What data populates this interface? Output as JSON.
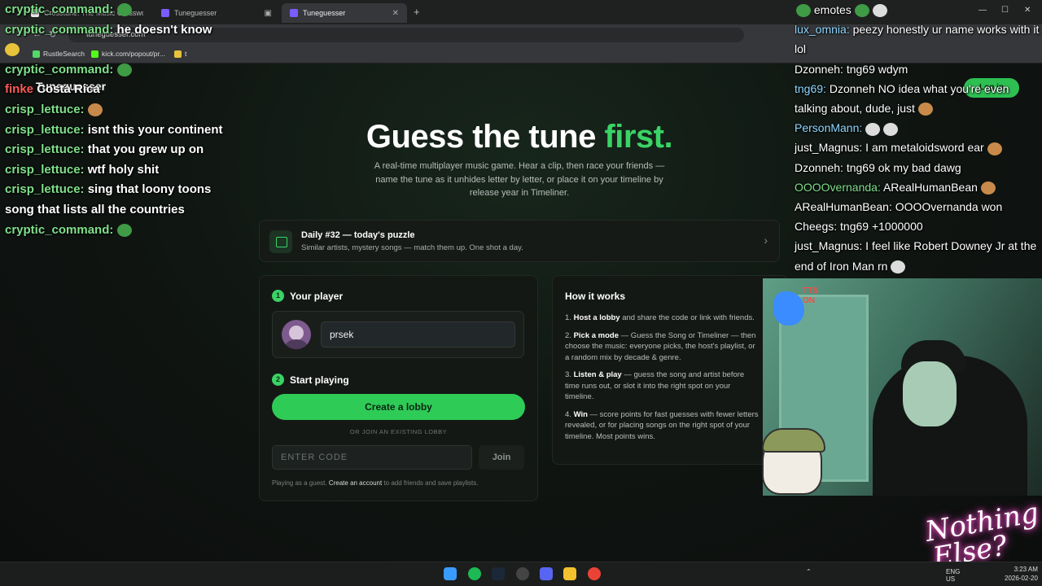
{
  "browser": {
    "tabs": [
      {
        "label": "Crosstune: The Music Crosswo..."
      },
      {
        "label": "Tuneguesser"
      },
      {
        "label": "Tuneguesser"
      }
    ],
    "new_tab": "+",
    "url": "tuneguesser.com",
    "bookmarks": [
      {
        "label": "RustleSearch"
      },
      {
        "label": "kick.com/popout/pr..."
      },
      {
        "label": "t"
      }
    ],
    "window_controls": {
      "minimize": "—",
      "maximize": "☐",
      "close": "✕"
    }
  },
  "header": {
    "brand": "Tuneguesser",
    "top_button": "Log in"
  },
  "hero": {
    "title_main": "Guess the tune ",
    "title_accent": "first.",
    "subtitle": "A real-time multiplayer music game. Hear a clip, then race your friends — name the tune as it unhides letter by letter, or place it on your timeline by release year in Timeliner."
  },
  "daily": {
    "title": "Daily #32 — today's puzzle",
    "subtitle": "Similar artists, mystery songs — match them up. One shot a day.",
    "chevron": "›"
  },
  "player_panel": {
    "step1_num": "1",
    "step1_label": "Your player",
    "name_value": "prsek",
    "step2_num": "2",
    "step2_label": "Start playing",
    "create_button": "Create a lobby",
    "or_text": "OR JOIN AN EXISTING LOBBY",
    "code_placeholder": "ENTER CODE",
    "join_button": "Join",
    "guest_text": "Playing as a guest. ",
    "guest_link": "Create an account",
    "guest_suffix": " to add friends and save playlists."
  },
  "how_it_works": {
    "title": "How it works",
    "items": [
      {
        "num": "1.",
        "bold": "Host a lobby",
        "text": " and share the code or link with friends."
      },
      {
        "num": "2.",
        "bold": "Pick a mode",
        "text": " — Guess the Song or Timeliner — then choose the music: everyone picks, the host's playlist, or a random mix by decade & genre."
      },
      {
        "num": "3.",
        "bold": "Listen & play",
        "text": " — guess the song and artist before time runs out, or slot it into the right spot on your timeline."
      },
      {
        "num": "4.",
        "bold": "Win",
        "text": " — score points for fast guesses with fewer letters revealed, or for placing songs on the right spot of your timeline. Most points wins."
      }
    ]
  },
  "chat_left": [
    {
      "user": "cryptic_command:",
      "text": ""
    },
    {
      "user": "cryptic_command:",
      "text": "he doesn't know"
    },
    {
      "user": "",
      "text": ""
    },
    {
      "user": "cryptic_command:",
      "text": ""
    },
    {
      "user": "finke",
      "text": "Costa Rica"
    },
    {
      "user": "crisp_lettuce:",
      "text": ""
    },
    {
      "user": "crisp_lettuce:",
      "text": "isnt this your continent"
    },
    {
      "user": "crisp_lettuce:",
      "text": "that you grew up on"
    },
    {
      "user": "crisp_lettuce:",
      "text": "wtf holy shit"
    },
    {
      "user": "crisp_lettuce:",
      "text": "sing that loony toons"
    },
    {
      "user": "",
      "text": "song that lists all the countries"
    },
    {
      "user": "cryptic_command:",
      "text": ""
    }
  ],
  "chat_right": [
    {
      "user": "",
      "text": "emotes"
    },
    {
      "user": "lux_omnia:",
      "text": " peezy honestly ur name works with it lol"
    },
    {
      "user": "Dzonneh:",
      "text": " tng69 wdym"
    },
    {
      "user": "tng69:",
      "text": " Dzonneh NO idea what you're even talking about, dude, just"
    },
    {
      "user": "PersonMann:",
      "text": ""
    },
    {
      "user": "just_Magnus:",
      "text": " I am metaloidsword ear"
    },
    {
      "user": "Dzonneh:",
      "text": " tng69 ok my bad dawg"
    },
    {
      "user": "OOOOvernanda:",
      "text": " ARealHumanBean"
    },
    {
      "user": "ARealHumanBean:",
      "text": " OOOOvernanda won"
    },
    {
      "user": "Cheegs:",
      "text": " tng69 +1000000"
    },
    {
      "user": "just_Magnus:",
      "text": " I feel like Robert Downey Jr at the end of Iron Man rn"
    }
  ],
  "overlay": {
    "tts_label": "TTS ON",
    "logo_line1": "Nothing",
    "logo_line2": "Else?"
  },
  "taskbar": {
    "lang": "ENG",
    "region": "US",
    "time": "3:23 AM",
    "date": "2026-02-20"
  },
  "colors": {
    "accent": "#3ad365",
    "background": "#0d0f0e",
    "panel": "#141815"
  }
}
